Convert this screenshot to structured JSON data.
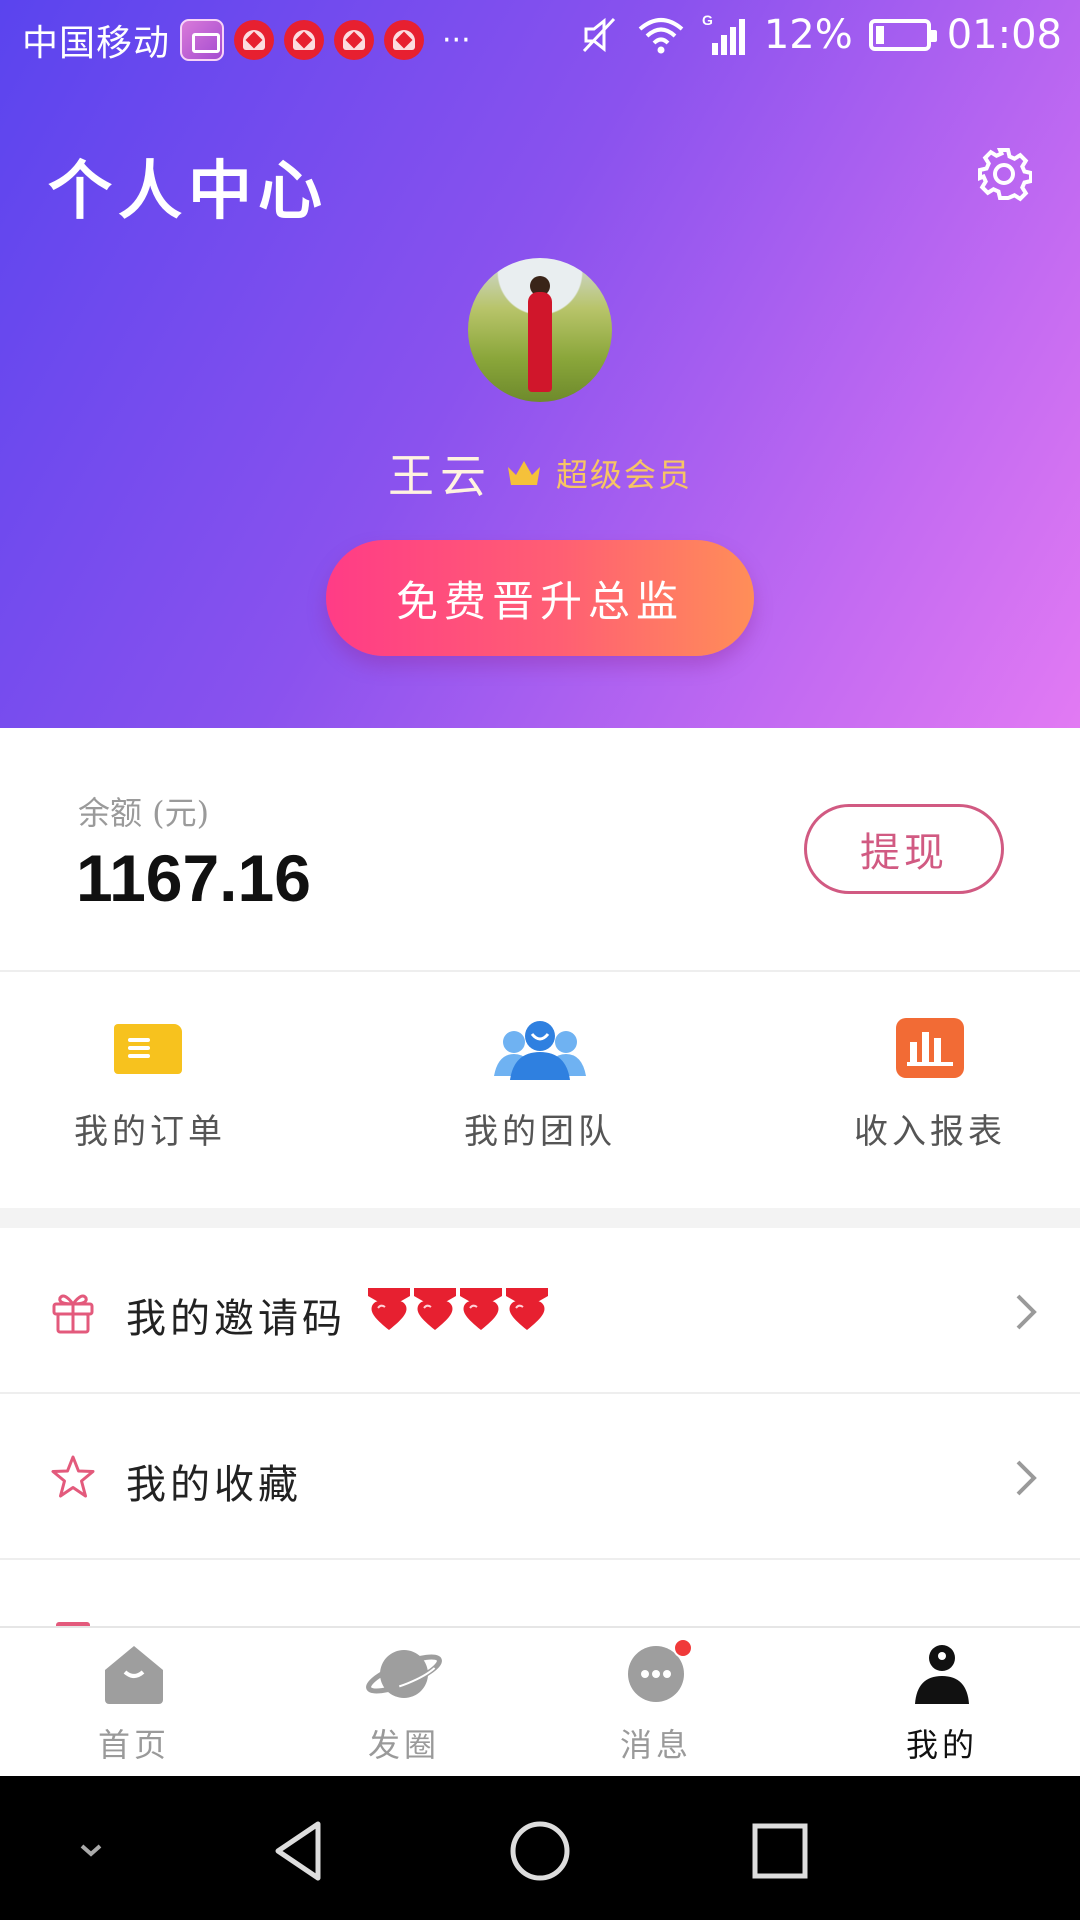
{
  "status_bar": {
    "carrier": "中国移动",
    "more": "···",
    "network": "G",
    "battery": "12%",
    "time": "01:08"
  },
  "header": {
    "title": "个人中心",
    "username": "王云",
    "member_level": "超级会员",
    "upgrade_button": "免费晋升总监"
  },
  "balance": {
    "label": "余额 (元)",
    "value": "1167.16",
    "withdraw_button": "提现"
  },
  "quick_actions": [
    {
      "label": "我的订单",
      "icon": "order-icon",
      "color": "#f7c21e"
    },
    {
      "label": "我的团队",
      "icon": "team-icon",
      "color": "#3a8fe8"
    },
    {
      "label": "收入报表",
      "icon": "report-icon",
      "color": "#f26b35"
    }
  ],
  "list": [
    {
      "label": "我的邀请码",
      "icon": "gift-icon"
    },
    {
      "label": "我的收藏",
      "icon": "star-icon"
    }
  ],
  "tabs": [
    {
      "label": "首页",
      "icon": "home-icon"
    },
    {
      "label": "发圈",
      "icon": "planet-icon"
    },
    {
      "label": "消息",
      "icon": "message-icon"
    },
    {
      "label": "我的",
      "icon": "profile-icon",
      "active": true
    }
  ],
  "colors": {
    "gradient_start": "#5a44ee",
    "gradient_end": "#e27af3",
    "accent_pink": "#d15a82",
    "member_gold": "#f7c564"
  }
}
